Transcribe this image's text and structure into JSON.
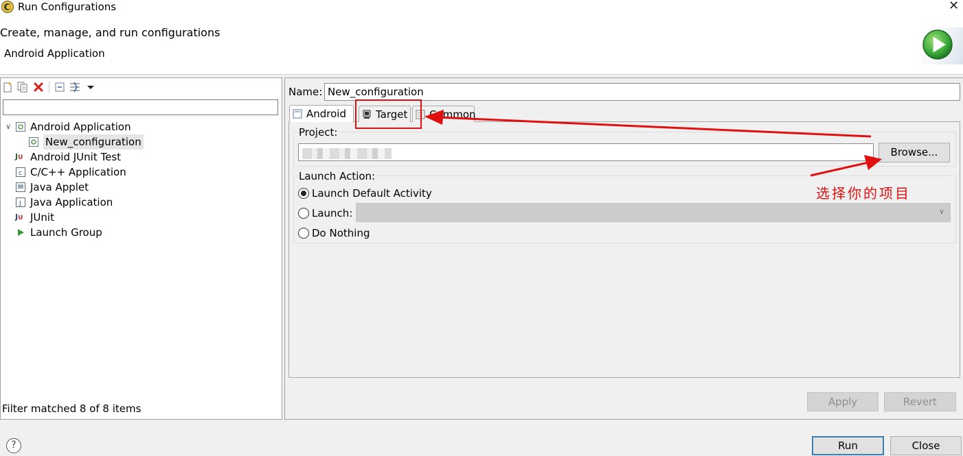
{
  "window": {
    "title": "Run Configurations",
    "close_glyph": "✕"
  },
  "header": {
    "title": "Create, manage, and run configurations",
    "subtitle": "Android Application",
    "banner_icon": "run-icon"
  },
  "toolbar": {
    "buttons": [
      "new-configuration-icon",
      "duplicate-icon",
      "delete-icon",
      "collapse-all-icon",
      "filter-icon",
      "dropdown-icon"
    ]
  },
  "filter": {
    "value": "",
    "status": "Filter matched 8 of 8 items"
  },
  "tree": {
    "items": [
      {
        "label": "Android Application",
        "expanded": true
      },
      {
        "label": "New_configuration",
        "selected": true
      },
      {
        "label": "Android JUnit Test"
      },
      {
        "label": "C/C++ Application"
      },
      {
        "label": "Java Applet"
      },
      {
        "label": "Java Application"
      },
      {
        "label": "JUnit"
      },
      {
        "label": "Launch Group"
      }
    ]
  },
  "config": {
    "name_label": "Name:",
    "name_value": "New_configuration",
    "tabs": [
      {
        "label": "Android",
        "active": true
      },
      {
        "label": "Target"
      },
      {
        "label": "Common"
      }
    ],
    "project_label": "Project:",
    "project_value": "",
    "browse_label": "Browse...",
    "launch_action_label": "Launch Action:",
    "options": [
      {
        "label": "Launch Default Activity",
        "checked": true
      },
      {
        "label": "Launch:",
        "checked": false
      },
      {
        "label": "Do Nothing",
        "checked": false
      }
    ],
    "launch_select_value": ""
  },
  "annotation": {
    "text": "选择你的项目",
    "color": "#e01010"
  },
  "buttons": {
    "apply": "Apply",
    "revert": "Revert",
    "run": "Run",
    "close": "Close",
    "help": "?"
  }
}
